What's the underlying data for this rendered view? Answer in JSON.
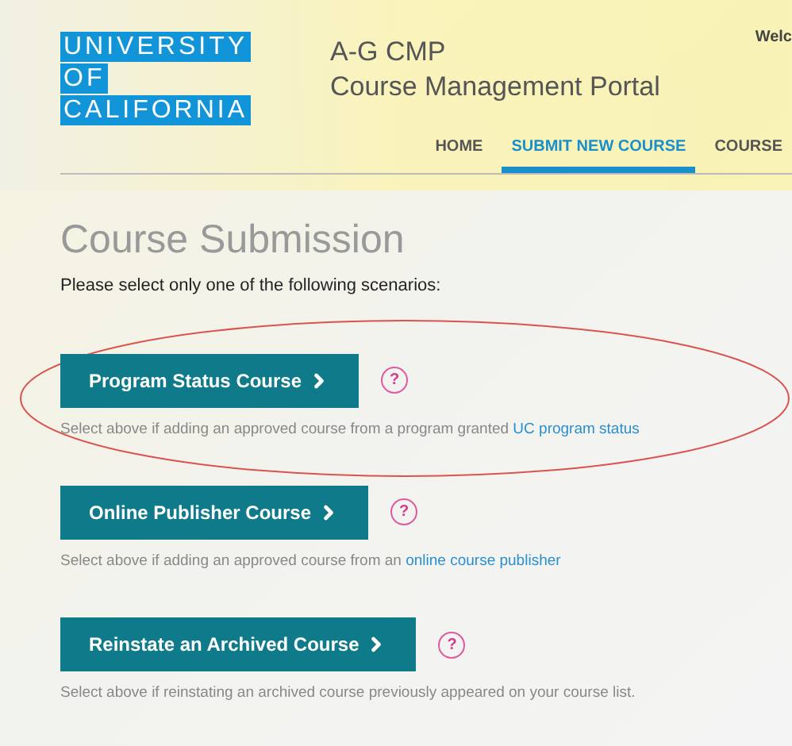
{
  "logo": {
    "lines": [
      "UNIVERSITY",
      "OF",
      "CALIFORNIA"
    ]
  },
  "portal": {
    "title": "A-G CMP",
    "subtitle": "Course Management Portal"
  },
  "welcome": "Welc",
  "nav": [
    {
      "label": "HOME",
      "selected": false
    },
    {
      "label": "SUBMIT NEW COURSE",
      "selected": true
    },
    {
      "label": "COURSE",
      "selected": false
    }
  ],
  "heading": "Course Submission",
  "instruction": "Please select only one of the following scenarios:",
  "scenarios": [
    {
      "button": "Program Status Course",
      "help": "?",
      "description": "Select above if adding an approved course from a program granted ",
      "link": "UC program status",
      "highlighted": true
    },
    {
      "button": "Online Publisher Course",
      "help": "?",
      "description": "Select above if adding an approved course from an ",
      "link": "online course publisher",
      "highlighted": false
    },
    {
      "button": "Reinstate an Archived Course",
      "help": "?",
      "description": "Select above if reinstating an archived course previously appeared on your course list.",
      "highlighted": false
    }
  ]
}
